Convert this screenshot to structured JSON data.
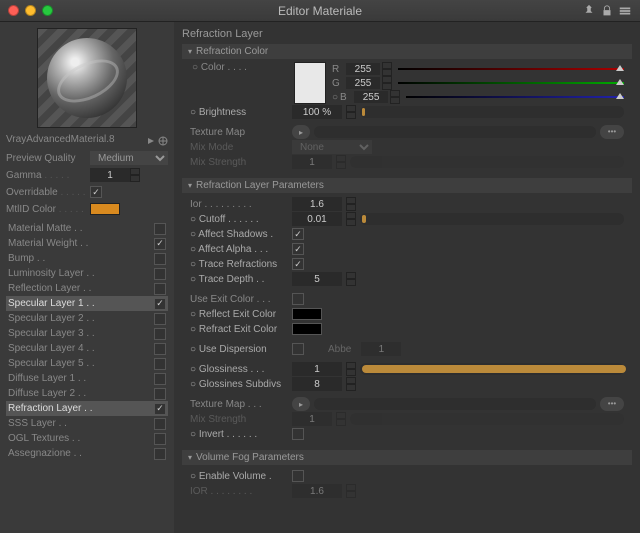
{
  "window": {
    "title": "Editor Materiale"
  },
  "sidebar": {
    "material_name": "VrayAdvancedMaterial.8",
    "preview_quality_label": "Preview Quality",
    "preview_quality_value": "Medium",
    "gamma_label": "Gamma",
    "gamma_value": "1",
    "overridable_label": "Overridable",
    "overridable_checked": "✓",
    "mtlid_label": "MtlID Color",
    "mtlid_color": "#d98a1f",
    "layers": [
      {
        "label": "Material Matte",
        "checked": "",
        "hi": false
      },
      {
        "label": "Material Weight",
        "checked": "✓",
        "hi": false
      },
      {
        "label": "Bump",
        "checked": "",
        "hi": false
      },
      {
        "label": "Luminosity Layer",
        "checked": "",
        "hi": false
      },
      {
        "label": "Reflection Layer",
        "checked": "",
        "hi": false
      },
      {
        "label": "Specular Layer 1",
        "checked": "✓",
        "hi": true
      },
      {
        "label": "Specular Layer 2",
        "checked": "",
        "hi": false
      },
      {
        "label": "Specular Layer 3",
        "checked": "",
        "hi": false
      },
      {
        "label": "Specular Layer 4",
        "checked": "",
        "hi": false
      },
      {
        "label": "Specular Layer 5",
        "checked": "",
        "hi": false
      },
      {
        "label": "Diffuse Layer 1",
        "checked": "",
        "hi": false
      },
      {
        "label": "Diffuse Layer 2",
        "checked": "",
        "hi": false
      },
      {
        "label": "Refraction Layer",
        "checked": "✓",
        "hi": true
      },
      {
        "label": "SSS Layer",
        "checked": "",
        "hi": false
      },
      {
        "label": "OGL Textures",
        "checked": "",
        "hi": false
      },
      {
        "label": "Assegnazione",
        "checked": "",
        "hi": false
      }
    ]
  },
  "panel": {
    "title": "Refraction Layer",
    "sec_color": "Refraction Color",
    "color_label": "Color",
    "r": "R",
    "g": "G",
    "b": "B",
    "r_val": "255",
    "g_val": "255",
    "b_val": "255",
    "brightness_label": "Brightness",
    "brightness_value": "100 %",
    "texmap_label": "Texture Map",
    "mixmode_label": "Mix Mode",
    "mixmode_value": "None",
    "mixstr_label": "Mix Strength",
    "mixstr_value": "1",
    "sec_params": "Refraction Layer Parameters",
    "ior_label": "Ior",
    "ior_value": "1.6",
    "cutoff_label": "Cutoff",
    "cutoff_value": "0.01",
    "affsh_label": "Affect Shadows",
    "affsh_checked": "✓",
    "affal_label": "Affect Alpha",
    "affal_checked": "✓",
    "tracere_label": "Trace Refractions",
    "tracere_checked": "✓",
    "traced_label": "Trace Depth",
    "traced_value": "5",
    "useexit_label": "Use Exit Color",
    "reflexit_label": "Reflect Exit Color",
    "refrexit_label": "Refract Exit Color",
    "usedisp_label": "Use Dispersion",
    "abbe_label": "Abbe",
    "abbe_value": "1",
    "gloss_label": "Glossiness",
    "gloss_value": "1",
    "glosssub_label": "Glossines Subdivs",
    "glosssub_value": "8",
    "texmap2_label": "Texture Map",
    "mixstr2_label": "Mix Strength",
    "mixstr2_value": "1",
    "invert_label": "Invert",
    "sec_fog": "Volume Fog Parameters",
    "envol_label": "Enable Volume",
    "ior2_label": "IOR",
    "ior2_value": "1.6"
  }
}
